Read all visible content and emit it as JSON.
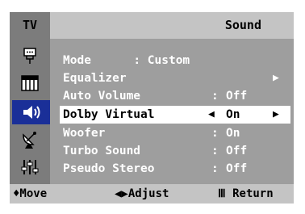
{
  "header": {
    "tv_label": "TV",
    "title": "Sound"
  },
  "sidebar": {
    "icons": [
      {
        "name": "input-icon",
        "glyph": "⏚"
      },
      {
        "name": "picture-icon",
        "glyph": "▥"
      },
      {
        "name": "sound-icon",
        "glyph": "◀))",
        "active": true
      },
      {
        "name": "channel-icon",
        "glyph": "⨳"
      },
      {
        "name": "setup-icon",
        "glyph": "☷"
      }
    ]
  },
  "menu": {
    "mode": {
      "label": "Mode",
      "value": ": Custom"
    },
    "equalizer": {
      "label": "Equalizer",
      "arrow": "▶"
    },
    "auto_volume": {
      "label": "Auto Volume",
      "colon": ":",
      "value": "Off"
    },
    "dolby_virtual": {
      "label": "Dolby Virtual",
      "arrow_left": "◀",
      "value": "On",
      "arrow_right": "▶"
    },
    "woofer": {
      "label": "Woofer",
      "colon": ":",
      "value": "On"
    },
    "turbo_sound": {
      "label": "Turbo Sound",
      "colon": ":",
      "value": "Off"
    },
    "pseudo_stereo": {
      "label": "Pseudo Stereo",
      "colon": ":",
      "value": "Off"
    }
  },
  "footer": {
    "move": "♦Move",
    "adjust": "◀▶Adjust",
    "return": "Ⅲ Return"
  },
  "colors": {
    "highlight": "#1a2f98",
    "panel": "#9e9e9e",
    "sidebar": "#7c7c7c",
    "bar": "#c4c4c4"
  }
}
